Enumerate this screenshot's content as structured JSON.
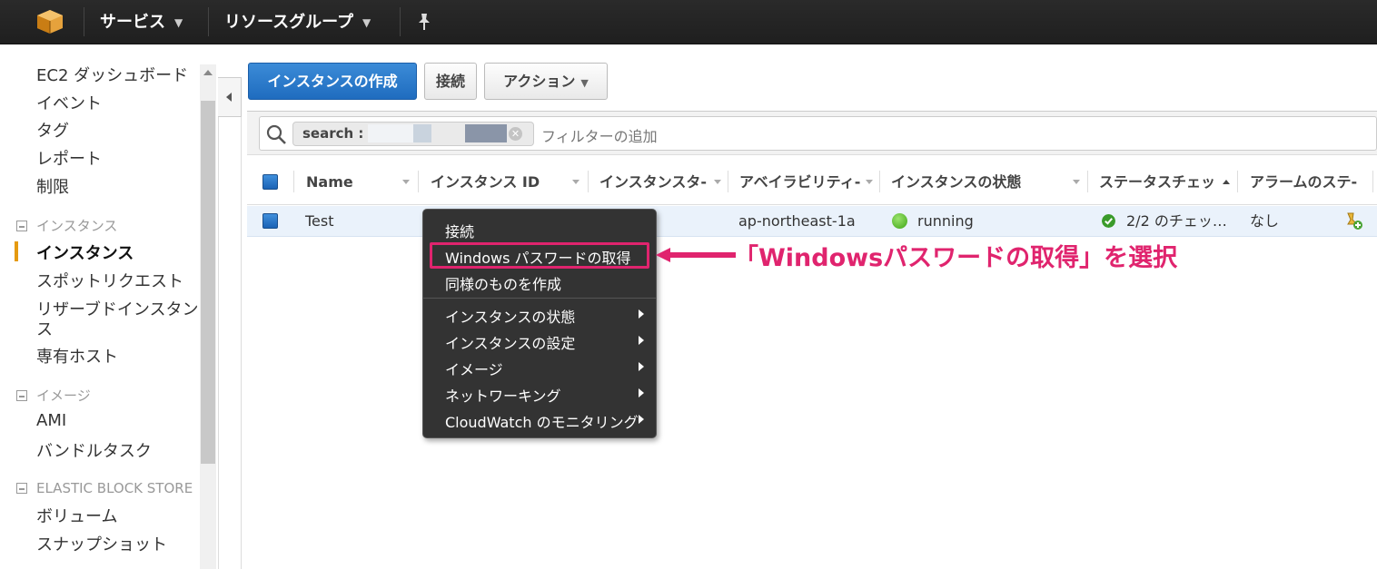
{
  "topbar": {
    "services_label": "サービス",
    "resource_groups_label": "リソースグループ"
  },
  "sidebar": {
    "items": [
      {
        "label": "EC2 ダッシュボード"
      },
      {
        "label": "イベント"
      },
      {
        "label": "タグ"
      },
      {
        "label": "レポート"
      },
      {
        "label": "制限"
      }
    ],
    "section_instances": "インスタンス",
    "instances_items": [
      {
        "label": "インスタンス",
        "active": true
      },
      {
        "label": "スポットリクエスト"
      },
      {
        "label": "リザーブドインスタンス"
      },
      {
        "label": "ス"
      },
      {
        "label": "専有ホスト"
      }
    ],
    "section_images": "イメージ",
    "images_items": [
      {
        "label": "AMI"
      },
      {
        "label": "バンドルタスク"
      }
    ],
    "section_ebs": "ELASTIC BLOCK STORE",
    "ebs_items": [
      {
        "label": "ボリューム"
      },
      {
        "label": "スナップショット"
      }
    ],
    "active_color": "#e59a10"
  },
  "toolbar": {
    "create_instance_label": "インスタンスの作成",
    "connect_label": "接続",
    "actions_label": "アクション"
  },
  "filter": {
    "token_label": "search :",
    "placeholder": "フィルターの追加"
  },
  "table": {
    "columns": [
      "Name",
      "インスタンス ID",
      "インスタンスタ-",
      "アベイラビリティ-",
      "インスタンスの状態",
      "ステータスチェッ",
      "アラームのステ-"
    ],
    "rows": [
      {
        "name": "Test",
        "instance_id": "",
        "instance_type": "",
        "availability_zone": "ap-northeast-1a",
        "state": "running",
        "status_check": "2/2 のチェッ…",
        "alarm_status": "なし"
      }
    ]
  },
  "context_menu": {
    "items": [
      {
        "label": "接続",
        "submenu": false
      },
      {
        "label": "Windows パスワードの取得",
        "submenu": false,
        "highlighted": true
      },
      {
        "label": "同様のものを作成",
        "submenu": false
      },
      {
        "label": "インスタンスの状態",
        "submenu": true
      },
      {
        "label": "インスタンスの設定",
        "submenu": true
      },
      {
        "label": "イメージ",
        "submenu": true
      },
      {
        "label": "ネットワーキング",
        "submenu": true
      },
      {
        "label": "CloudWatch のモニタリング",
        "submenu": true
      }
    ]
  },
  "annotation": {
    "text": "「Windowsパスワードの取得」を選択",
    "color": "#e0246e"
  },
  "colors": {
    "primary_button": "#1f6cbf",
    "running_green": "#3ea516",
    "selected_row": "#eaf2fb"
  }
}
